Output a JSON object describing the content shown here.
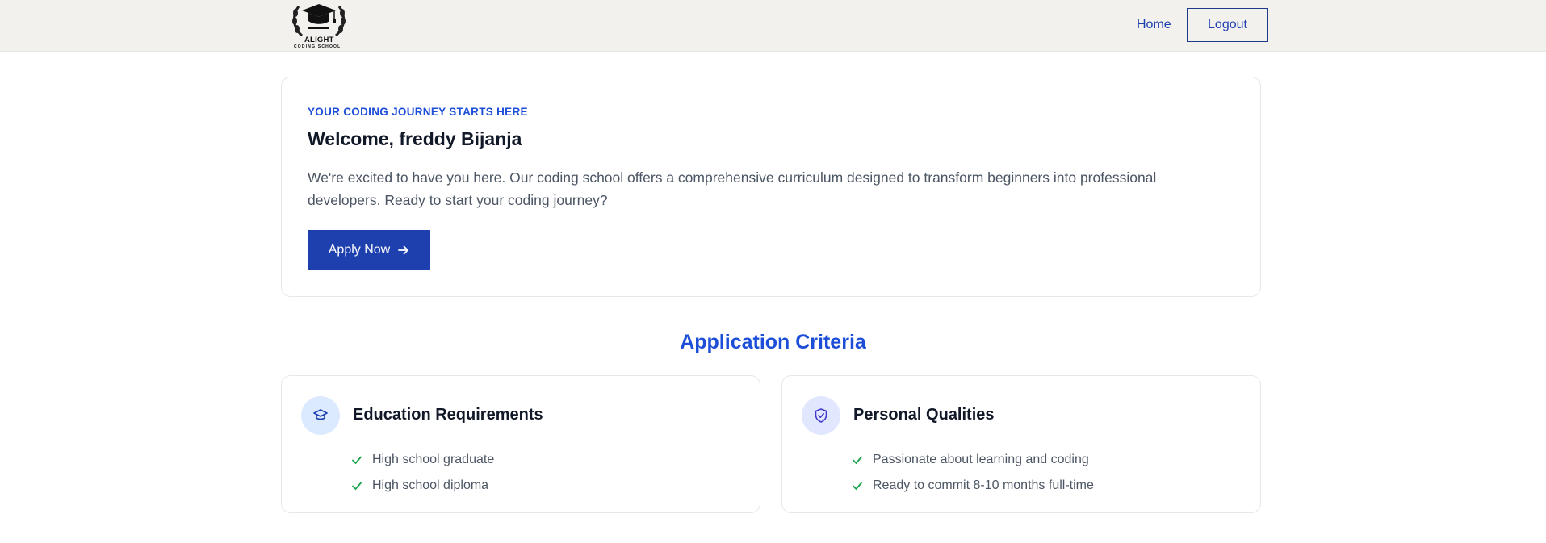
{
  "nav": {
    "logo_text": "ALIGHT",
    "logo_subtext": "CODING SCHOOL",
    "home_label": "Home",
    "logout_label": "Logout"
  },
  "hero": {
    "eyebrow": "YOUR CODING JOURNEY STARTS HERE",
    "welcome": "Welcome, freddy Bijanja",
    "intro": "We're excited to have you here. Our coding school offers a comprehensive curriculum designed to transform beginners into professional developers. Ready to start your coding journey?",
    "apply_label": "Apply Now",
    "apply_icon": "arrow-right-icon"
  },
  "criteria": {
    "title": "Application Criteria",
    "cards": [
      {
        "title": "Education Requirements",
        "icon": "graduation-cap-icon",
        "items": [
          "High school graduate",
          "High school diploma"
        ]
      },
      {
        "title": "Personal Qualities",
        "icon": "shield-check-icon",
        "items": [
          "Passionate about learning and coding",
          "Ready to commit 8-10 months full-time"
        ]
      }
    ]
  },
  "colors": {
    "accent": "#1d4ed8",
    "button": "#1e40af",
    "check": "#16a34a",
    "navbar_bg": "#f2f1ee"
  }
}
